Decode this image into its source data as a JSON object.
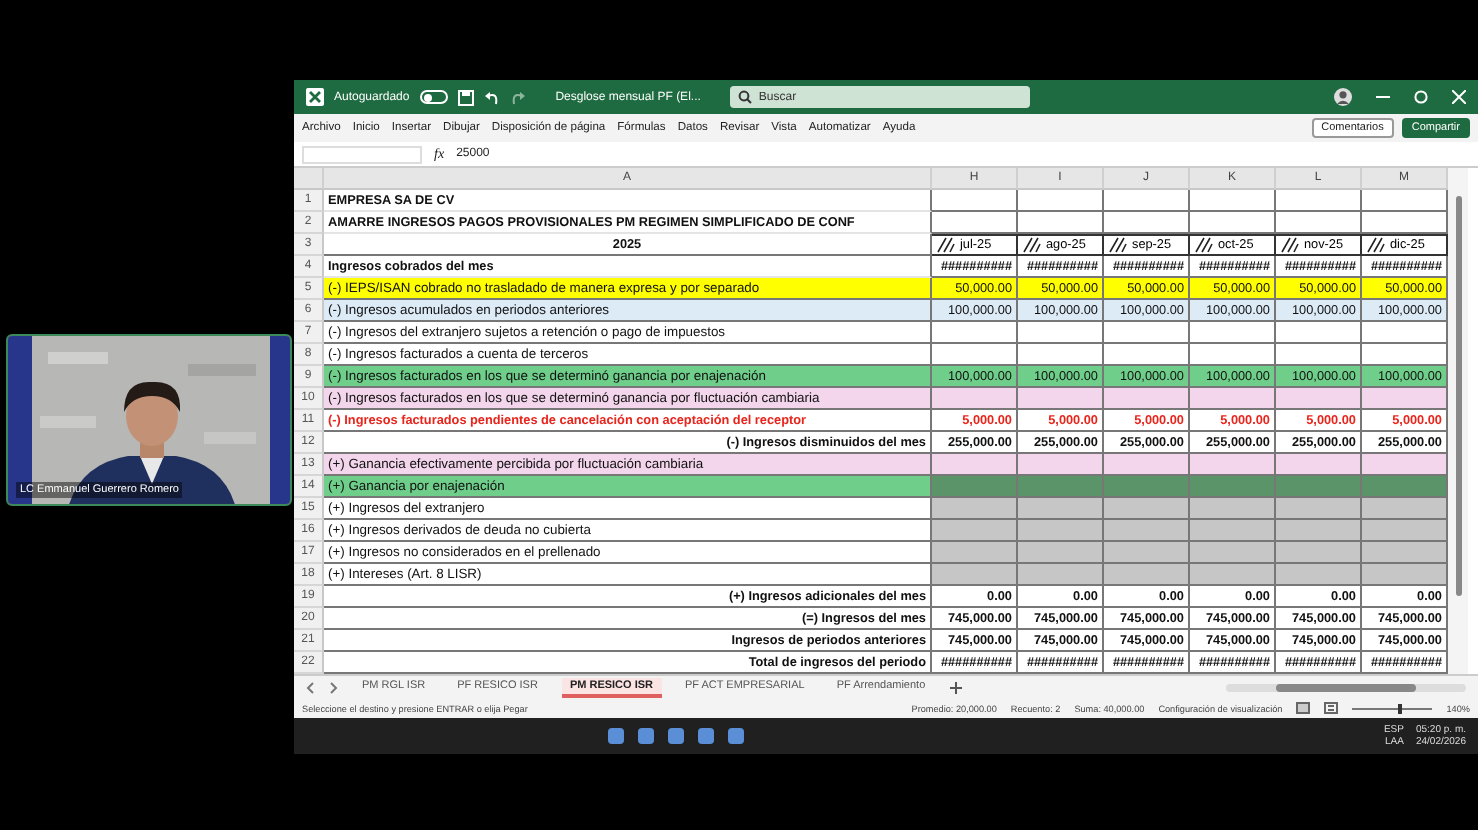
{
  "video_tile": {
    "kind": "picture",
    "caption": "LC Emmanuel Guerrero Romero"
  },
  "window": {
    "autosave_label": "Autoguardado",
    "autosave_on": false,
    "title": "Desglose mensual PF (El...",
    "search": {
      "placeholder": "Buscar"
    }
  },
  "menu": [
    "Archivo",
    "Inicio",
    "Insertar",
    "Dibujar",
    "Disposición de página",
    "Fórmulas",
    "Datos",
    "Revisar",
    "Vista",
    "Automatizar",
    "Ayuda"
  ],
  "ribbon_buttons": [
    "Comentarios",
    "Compartir"
  ],
  "formula_bar": {
    "function_label": "fx",
    "value": "25000"
  },
  "columns": [
    "A",
    "H",
    "I",
    "J",
    "K",
    "L",
    "M"
  ],
  "rows": [
    {
      "number": "1",
      "kind": "heading",
      "label": "EMPRESA SA DE CV",
      "values": []
    },
    {
      "number": "2",
      "kind": "heading",
      "label": "AMARRE INGRESOS PAGOS PROVISIONALES PM REGIMEN SIMPLIFICADO DE CONF",
      "values": []
    },
    {
      "number": "3",
      "kind": "year",
      "label": "2025",
      "values": [
        "jul-25",
        "ago-25",
        "sep-25",
        "oct-25",
        "nov-25",
        "dic-25"
      ]
    },
    {
      "number": "4",
      "kind": "heading",
      "label": "Ingresos cobrados del mes",
      "values": [
        "##########",
        "##########",
        "##########",
        "##########",
        "##########",
        "##########"
      ]
    },
    {
      "number": "5",
      "kind": "item",
      "color": "#ffff00",
      "label": "(-) IEPS/ISAN cobrado no trasladado de manera expresa y por separado",
      "values": [
        "50,000.00",
        "50,000.00",
        "50,000.00",
        "50,000.00",
        "50,000.00",
        "50,000.00"
      ]
    },
    {
      "number": "6",
      "kind": "item",
      "color": "#ddebf7",
      "label": "(-) Ingresos acumulados en periodos anteriores",
      "values": [
        "100,000.00",
        "100,000.00",
        "100,000.00",
        "100,000.00",
        "100,000.00",
        "100,000.00"
      ]
    },
    {
      "number": "7",
      "kind": "item",
      "color": "#ffffff",
      "label": "(-) Ingresos del extranjero sujetos a retención o pago de impuestos",
      "values": []
    },
    {
      "number": "8",
      "kind": "item",
      "color": "#ffffff",
      "label": "(-) Ingresos facturados a cuenta de terceros",
      "values": []
    },
    {
      "number": "9",
      "kind": "item",
      "color": "#6fcf8a",
      "label": "(-) Ingresos facturados en los que se determinó ganancia por enajenación",
      "values": [
        "100,000.00",
        "100,000.00",
        "100,000.00",
        "100,000.00",
        "100,000.00",
        "100,000.00"
      ]
    },
    {
      "number": "10",
      "kind": "item",
      "color": "#f4d6ec",
      "label": "(-) Ingresos facturados en los que se determinó ganancia por fluctuación cambiaria",
      "values": []
    },
    {
      "number": "11",
      "kind": "alert",
      "color": "#ffffff",
      "label": "(-) Ingresos facturados pendientes de cancelación con aceptación del receptor",
      "values": [
        "5,000.00",
        "5,000.00",
        "5,000.00",
        "5,000.00",
        "5,000.00",
        "5,000.00"
      ]
    },
    {
      "number": "12",
      "kind": "total",
      "label": "(-) Ingresos disminuidos del mes",
      "values": [
        "255,000.00",
        "255,000.00",
        "255,000.00",
        "255,000.00",
        "255,000.00",
        "255,000.00"
      ]
    },
    {
      "number": "13",
      "kind": "item",
      "color": "#f4d6ec",
      "label": "(+) Ganancia efectivamente percibida por fluctuación cambiaria",
      "values": []
    },
    {
      "number": "14",
      "kind": "item",
      "color": "#6fcf8a",
      "shaded": true,
      "label": "(+) Ganancia por enajenación",
      "values": []
    },
    {
      "number": "15",
      "kind": "item",
      "color": "#ffffff",
      "shaded": true,
      "label": "(+) Ingresos del extranjero",
      "values": []
    },
    {
      "number": "16",
      "kind": "item",
      "color": "#ffffff",
      "shaded": true,
      "label": "(+) Ingresos derivados de deuda no cubierta",
      "values": []
    },
    {
      "number": "17",
      "kind": "item",
      "color": "#ffffff",
      "shaded": true,
      "label": "(+) Ingresos no considerados en el prellenado",
      "values": []
    },
    {
      "number": "18",
      "kind": "item",
      "color": "#ffffff",
      "shaded": true,
      "label": "(+) Intereses (Art. 8 LISR)",
      "values": []
    },
    {
      "number": "19",
      "kind": "total",
      "label": "(+) Ingresos adicionales del mes",
      "values": [
        "0.00",
        "0.00",
        "0.00",
        "0.00",
        "0.00",
        "0.00"
      ]
    },
    {
      "number": "20",
      "kind": "total",
      "label": "(=) Ingresos del mes",
      "values": [
        "745,000.00",
        "745,000.00",
        "745,000.00",
        "745,000.00",
        "745,000.00",
        "745,000.00"
      ]
    },
    {
      "number": "21",
      "kind": "total",
      "label": "Ingresos de periodos anteriores",
      "values": [
        "745,000.00",
        "745,000.00",
        "745,000.00",
        "745,000.00",
        "745,000.00",
        "745,000.00"
      ]
    },
    {
      "number": "22",
      "kind": "total",
      "label": "Total de ingresos del periodo",
      "values": [
        "##########",
        "##########",
        "##########",
        "##########",
        "##########",
        "##########"
      ]
    }
  ],
  "sheet_tabs": [
    {
      "label": "PM RGL ISR",
      "selected": false
    },
    {
      "label": "PF RESICO ISR",
      "selected": false
    },
    {
      "label": "PM RESICO ISR",
      "selected": true
    },
    {
      "label": "PF ACT EMPRESARIAL",
      "selected": false
    },
    {
      "label": "PF Arrendamiento",
      "selected": false
    }
  ],
  "status_bar": {
    "message": "Seleccione el destino y presione ENTRAR o elija Pegar",
    "stats": [
      "Promedio: 20,000.00",
      "Recuento: 2",
      "Suma: 40,000.00"
    ],
    "display_settings": "Configuración de visualización",
    "zoom": {
      "level": 0.6,
      "reading": "140%"
    }
  },
  "taskbar": {
    "language": "ESP",
    "layout": "LAA",
    "time": "05:20 p. m.",
    "date": "24/02/2026"
  }
}
